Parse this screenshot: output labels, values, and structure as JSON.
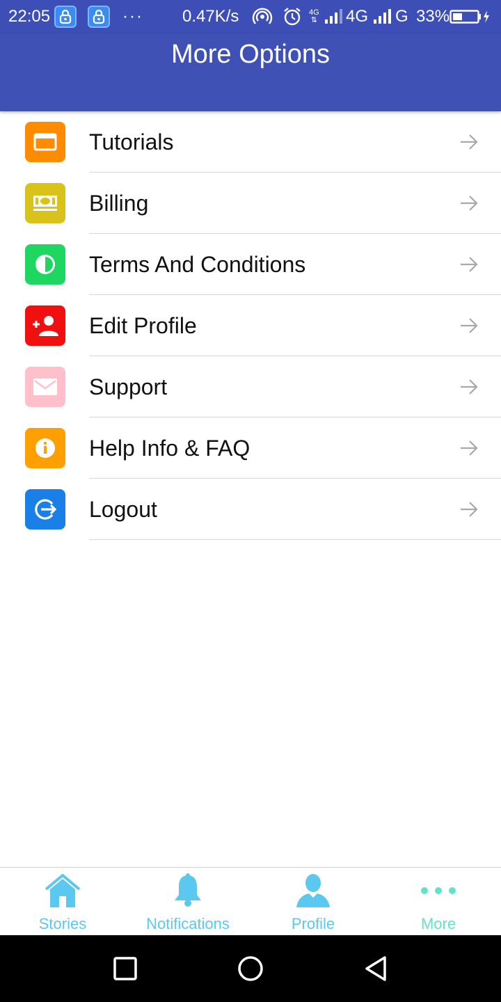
{
  "status_bar": {
    "time": "22:05",
    "more": "···",
    "net_speed": "0.47K/s",
    "net1": "4G",
    "net2": "4G",
    "net3": "G",
    "battery": "33%"
  },
  "header": {
    "title": "More Options",
    "background": "#3f51b5"
  },
  "menu": {
    "items": [
      {
        "label": "Tutorials",
        "icon": "tutorials-window-icon",
        "color": "#ff8c00"
      },
      {
        "label": "Billing",
        "icon": "billing-money-icon",
        "color": "#d9c21a"
      },
      {
        "label": "Terms And Conditions",
        "icon": "terms-contrast-icon",
        "color": "#1ed760"
      },
      {
        "label": "Edit Profile",
        "icon": "add-user-icon",
        "color": "#f01010"
      },
      {
        "label": "Support",
        "icon": "mail-icon",
        "color": "#ffc0cb"
      },
      {
        "label": "Help Info & FAQ",
        "icon": "info-icon",
        "color": "#ffa000"
      },
      {
        "label": "Logout",
        "icon": "logout-icon",
        "color": "#1a7fe6"
      }
    ]
  },
  "bottom_nav": {
    "items": [
      {
        "label": "Stories",
        "icon": "home-icon"
      },
      {
        "label": "Notifications",
        "icon": "bell-icon"
      },
      {
        "label": "Profile",
        "icon": "person-icon"
      },
      {
        "label": "More",
        "icon": "more-dots-icon",
        "active": true
      }
    ],
    "color": "#5bc8ef",
    "active_color": "#62e3c8"
  }
}
